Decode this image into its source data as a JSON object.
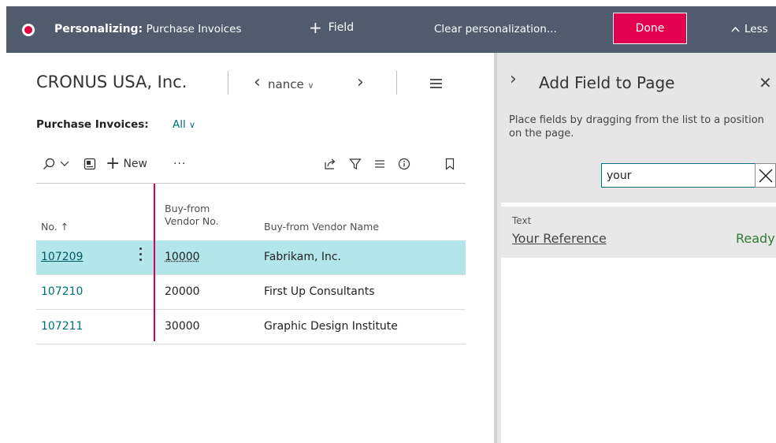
{
  "topbar": {
    "title_bold": "Personalizing:",
    "title_page": "Purchase Invoices",
    "add_field_label": "Field",
    "clear_label": "Clear personalization...",
    "done_label": "Done",
    "less_label": "Less"
  },
  "page": {
    "company": "CRONUS USA, Inc.",
    "nav_text": "nance",
    "list_title": "Purchase Invoices:",
    "filter": "All",
    "toolbar": {
      "new_label": "New",
      "more_label": "···"
    },
    "columns": [
      {
        "label": "No. ↑"
      },
      {
        "label": "Buy-from Vendor No."
      },
      {
        "label": "Buy-from Vendor Name"
      }
    ],
    "rows": [
      {
        "no": "107209",
        "vendor_no": "10000",
        "vendor_name": "Fabrikam, Inc.",
        "selected": true
      },
      {
        "no": "107210",
        "vendor_no": "20000",
        "vendor_name": "First Up Consultants",
        "selected": false
      },
      {
        "no": "107211",
        "vendor_no": "30000",
        "vendor_name": "Graphic Design Institute",
        "selected": false
      }
    ]
  },
  "pane": {
    "title": "Add Field to Page",
    "hint": "Place fields by dragging from the list to a position on the page.",
    "search_value": "your",
    "result": {
      "type": "Text",
      "name": "Your Reference",
      "status": "Ready"
    }
  },
  "colors": {
    "topbar_bg": "#505c6d",
    "done_bg": "#e3004f",
    "accent_teal": "#00707a",
    "selected_row": "#b2e6ea",
    "field_marker": "#d50057",
    "ready_green": "#2e7d32"
  }
}
